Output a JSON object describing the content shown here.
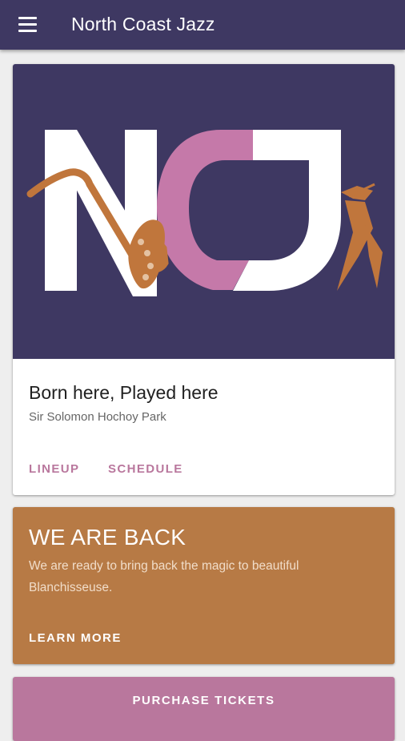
{
  "app_bar": {
    "title": "North Coast Jazz",
    "menu_icon": "hamburger-menu-icon"
  },
  "event_card": {
    "logo_text": "NCJ",
    "title": "Born here, Played here",
    "subtitle": "Sir Solomon Hochoy Park",
    "actions": [
      "LINEUP",
      "SCHEDULE"
    ]
  },
  "news_card": {
    "title": "WE ARE BACK",
    "body": "We are ready to bring back the magic to beautiful Blanchisseuse.",
    "action": "LEARN MORE"
  },
  "tickets_card": {
    "label": "PURCHASE TICKETS"
  },
  "colors": {
    "primary": "#3e3862",
    "accent_pink": "#b9779d",
    "accent_orange": "#b77a45",
    "background": "#eeeeee"
  }
}
